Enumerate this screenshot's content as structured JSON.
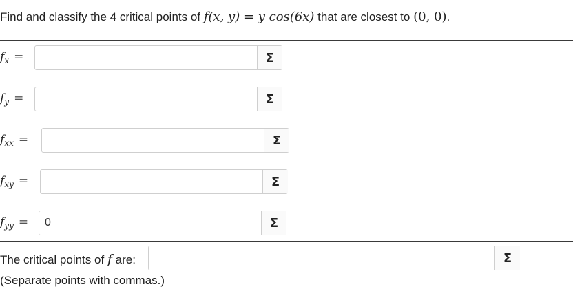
{
  "question": {
    "prefix": "Find and classify the 4 critical points of ",
    "func": "f(x, y) = y cos(6x)",
    "middle": " that are closest to ",
    "point": "(0, 0)",
    "suffix": "."
  },
  "fields": [
    {
      "symbol": "f",
      "sub": "x",
      "value": ""
    },
    {
      "symbol": "f",
      "sub": "y",
      "value": ""
    },
    {
      "symbol": "f",
      "sub": "xx",
      "value": ""
    },
    {
      "symbol": "f",
      "sub": "xy",
      "value": ""
    },
    {
      "symbol": "f",
      "sub": "yy",
      "value": "0"
    }
  ],
  "equals": "=",
  "sigma_icon": "Σ",
  "critical_points": {
    "label_before": "The critical points of ",
    "label_f": "f",
    "label_after": " are:",
    "value": "",
    "note": "(Separate points with commas.)"
  }
}
